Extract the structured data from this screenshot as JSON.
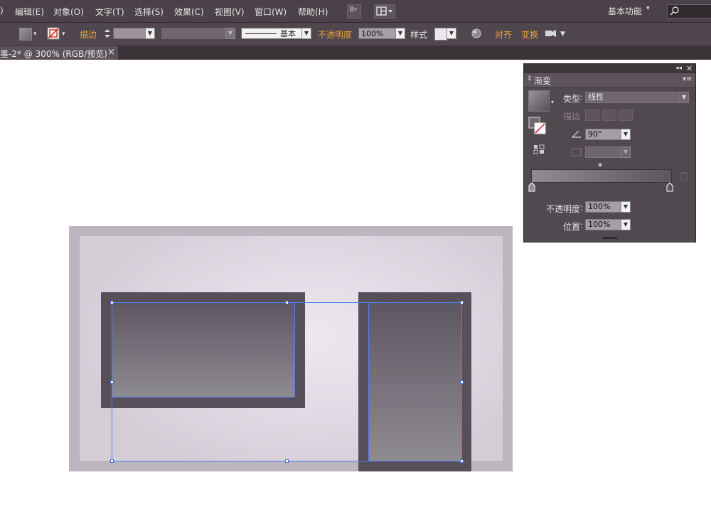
{
  "menubar": {
    "items": [
      "编辑(E)",
      "对象(O)",
      "文字(T)",
      "选择(S)",
      "效果(C)",
      "视图(V)",
      "窗口(W)",
      "帮助(H)"
    ],
    "leading_fragment": ")",
    "br_label": "Br",
    "workspace": "基本功能",
    "search_placeholder": ""
  },
  "controlbar": {
    "stroke_label": "描边",
    "stroke_style": "基本",
    "opacity_label": "不透明度",
    "opacity_value": "100%",
    "style_label": "样式",
    "align_label": "对齐",
    "transform_label": "变换"
  },
  "document": {
    "tab_label": "墨-2* @ 300% (RGB/预览)",
    "close": "×"
  },
  "gradient_panel": {
    "title": "渐变",
    "collapse": "◂◂",
    "close": "✕",
    "menu": "▾≡",
    "type_label": "类型",
    "type_value": "线性",
    "stroke_label": "描边",
    "angle_value": "90°",
    "opacity_label": "不透明度",
    "opacity_value": "100%",
    "position_label": "位置",
    "position_value": "100%"
  },
  "colors": {
    "menubar_bg": "#4a4248",
    "panel_bg": "#514950",
    "accent_orange": "#e8a03a",
    "selection_blue": "#4f7ff0"
  }
}
